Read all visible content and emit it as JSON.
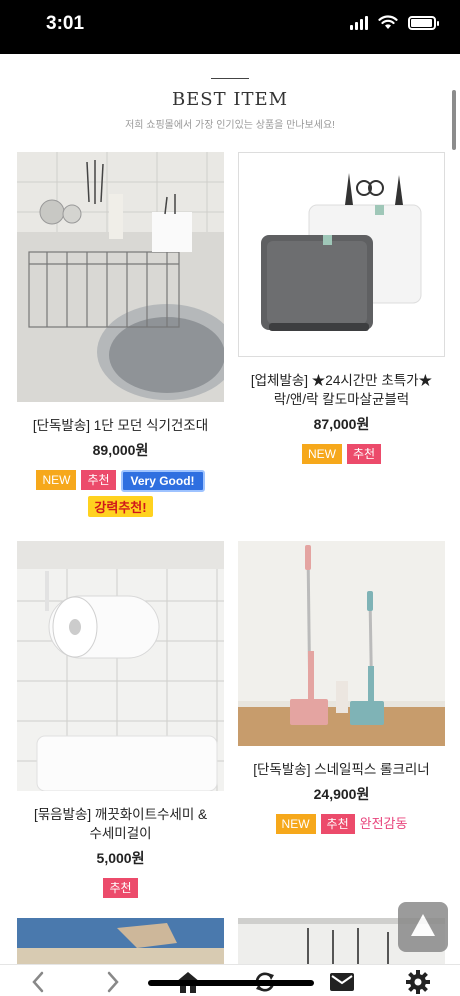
{
  "status": {
    "time": "3:01"
  },
  "header": {
    "title": "BEST ITEM",
    "subtitle": "저희 쇼핑몰에서 가장 인기있는 상품을 만나보세요!"
  },
  "products": [
    {
      "name": "[단독발송] 1단 모던 식기건조대",
      "price": "89,000원",
      "badges": [
        "NEW",
        "추천",
        "Very Good!"
      ],
      "extra": "강력추천!"
    },
    {
      "name_line1": "[업체발송] ★24시간만 초특가★",
      "name_line2": "락/앤/락 칼도마살균블럭",
      "price": "87,000원",
      "badges": [
        "NEW",
        "추천"
      ]
    },
    {
      "name_line1": "[묶음발송] 깨끗화이트수세미 &",
      "name_line2": "수세미걸이",
      "price": "5,000원",
      "badges": [
        "추천"
      ]
    },
    {
      "name": "[단독발송] 스네일픽스 롤크리너",
      "price": "24,900원",
      "badges": [
        "NEW",
        "추천"
      ],
      "extra": "완전감동"
    }
  ],
  "icons": {
    "back": "chevron-left-icon",
    "forward": "chevron-right-icon",
    "home": "home-icon",
    "refresh": "refresh-icon",
    "mail": "mail-icon",
    "settings": "gear-icon",
    "top": "scroll-top-icon"
  },
  "colors": {
    "new_badge": "#f6a81b",
    "recommend_badge": "#ec4b6b",
    "very_good_badge": "#2f6fe0"
  }
}
